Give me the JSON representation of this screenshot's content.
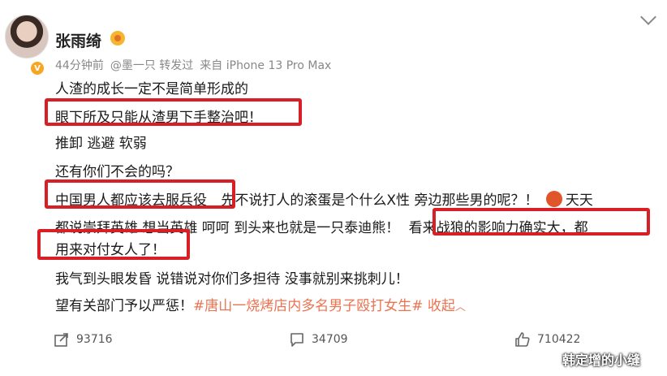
{
  "post": {
    "username": "张雨绮",
    "meta": {
      "time": "44分钟前",
      "repost_from": "@墨一只 转发过",
      "source": "来自 iPhone 13 Pro Max"
    },
    "lines": [
      "人渣的成长一定不是简单形成的",
      "眼下所及只能从渣男下手整治吧！",
      "推卸 逃避 软弱",
      "还有你们不会的吗？",
      "中国男人都应该去服兵役",
      "先不说打人的滚蛋是个什么X性 旁边那些男的呢？！",
      "天天",
      "都说崇拜英雄 想当英雄 呵呵 到头来也就是一只泰迪熊！",
      "看来战狼的影响力确实大，都",
      "用来对付女人了！",
      "我气到头眼发昏 说错说对你们多担待 没事就别来挑刺儿！",
      "望有关部门予以严惩！",
      "#唐山一烧烤店内多名男子殴打女生#",
      "收起"
    ],
    "actions": {
      "repost_count": "93716",
      "comment_count": "34709",
      "like_count": "710422"
    }
  },
  "watermark": "韩定增的小缝",
  "colors": {
    "highlight": "#d91f26",
    "link": "#eb7350",
    "meta": "#888888"
  }
}
